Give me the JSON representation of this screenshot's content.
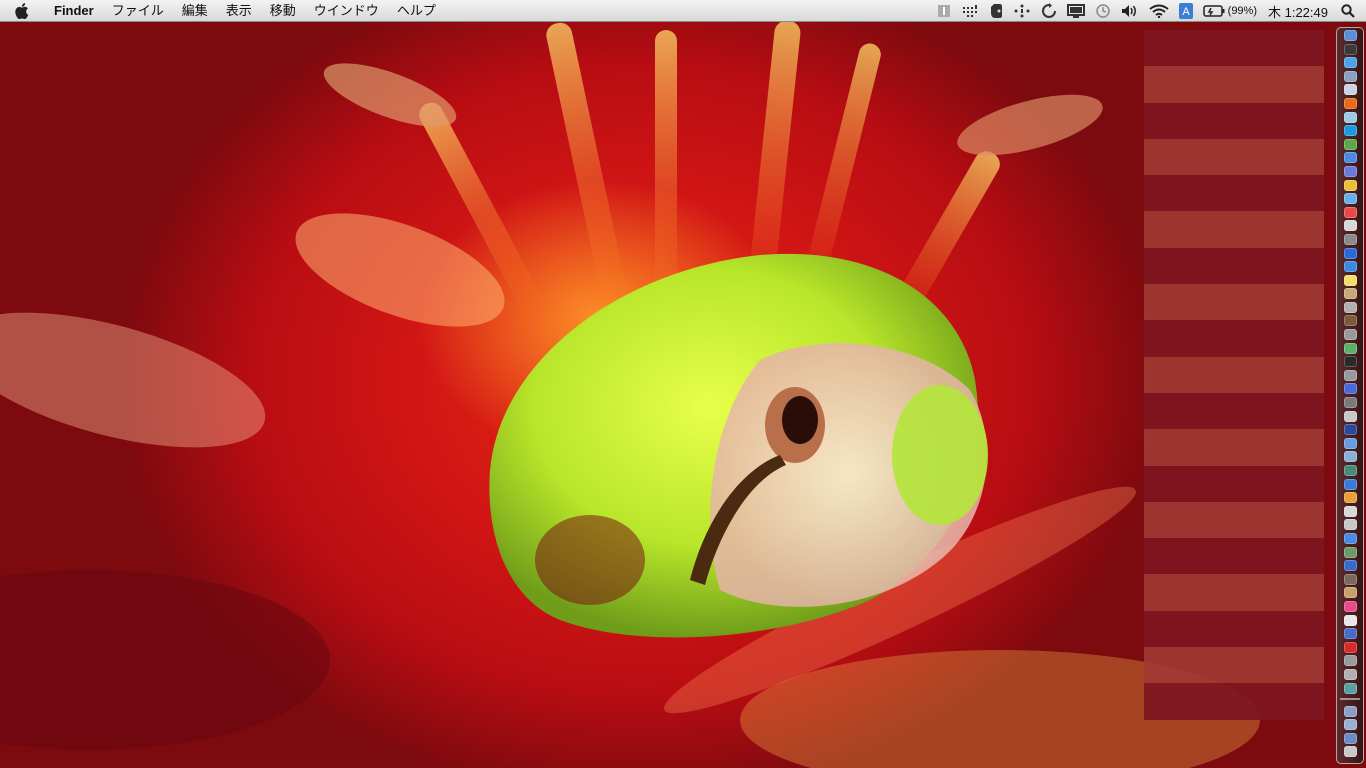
{
  "menubar": {
    "apple_icon": "apple-logo-icon",
    "app_name": "Finder",
    "menus": [
      "ファイル",
      "編集",
      "表示",
      "移動",
      "ウインドウ",
      "ヘルプ"
    ],
    "status_icons": [
      "info-icon",
      "menu-extra-icon",
      "evernote-icon",
      "bluetooth-icon",
      "sync-icon",
      "display-icon",
      "time-machine-icon",
      "volume-icon",
      "wifi-icon",
      "input-method-icon"
    ],
    "input_method_label": "A",
    "battery_percent": "(99%)",
    "clock": "木 1:22:49",
    "spotlight_icon": "spotlight-search-icon"
  },
  "desktop": {
    "wallpaper": "frog-in-red-flower",
    "pixelated_region": "redacted-desktop-items"
  },
  "dock": {
    "position": "right",
    "apps": [
      {
        "name": "finder-icon",
        "color": "#5a8fd8"
      },
      {
        "name": "dashboard-icon",
        "color": "#3a3a3a"
      },
      {
        "name": "safari-icon",
        "color": "#4aa3e8"
      },
      {
        "name": "mail-icon",
        "color": "#8aa0c0"
      },
      {
        "name": "preview-icon",
        "color": "#c8d4e4"
      },
      {
        "name": "firefox-icon",
        "color": "#e86a1a"
      },
      {
        "name": "twitter-icon",
        "color": "#9ccbe8"
      },
      {
        "name": "skype-icon",
        "color": "#1a9ae0"
      },
      {
        "name": "evernote-icon",
        "color": "#5aa84a"
      },
      {
        "name": "chrome-icon",
        "color": "#4a8ae0"
      },
      {
        "name": "itunes-icon",
        "color": "#6a7ad8"
      },
      {
        "name": "photo-icon",
        "color": "#e8c03a"
      },
      {
        "name": "app-store-icon",
        "color": "#6ab0e8"
      },
      {
        "name": "calendar-icon",
        "color": "#e84a4a"
      },
      {
        "name": "textedit-icon",
        "color": "#d8d8d8"
      },
      {
        "name": "system-prefs-icon",
        "color": "#8a8a8a"
      },
      {
        "name": "earth-icon",
        "color": "#2a6ad8"
      },
      {
        "name": "ie-icon",
        "color": "#3a8ae0"
      },
      {
        "name": "stickies-icon",
        "color": "#f0e06a"
      },
      {
        "name": "photos-icon",
        "color": "#c8a87a"
      },
      {
        "name": "image-icon",
        "color": "#b0b0b0"
      },
      {
        "name": "tools-icon",
        "color": "#7a5a3a"
      },
      {
        "name": "automator-icon",
        "color": "#9a9a9a"
      },
      {
        "name": "notes-icon",
        "color": "#5ab06a"
      },
      {
        "name": "terminal-icon",
        "color": "#2a2a2a"
      },
      {
        "name": "cloud-icon",
        "color": "#9a9a9a"
      },
      {
        "name": "presentation-icon",
        "color": "#4a6ad8"
      },
      {
        "name": "vmware-icon",
        "color": "#7a7a7a"
      },
      {
        "name": "pen-icon",
        "color": "#c8c8c8"
      },
      {
        "name": "photoshop-icon",
        "color": "#2a4a9a"
      },
      {
        "name": "folder-icon",
        "color": "#6a9ae0"
      },
      {
        "name": "network-icon",
        "color": "#8ab0d8"
      },
      {
        "name": "screen-icon",
        "color": "#4a8a7a"
      },
      {
        "name": "quicktime-icon",
        "color": "#3a7ad8"
      },
      {
        "name": "pencil-icon",
        "color": "#e8a03a"
      },
      {
        "name": "document-icon",
        "color": "#d8d8d8"
      },
      {
        "name": "paint-icon",
        "color": "#c8c8c8"
      },
      {
        "name": "messages-icon",
        "color": "#4a8ae0"
      },
      {
        "name": "spreadsheet-icon",
        "color": "#6a9a6a"
      },
      {
        "name": "nav-icon",
        "color": "#3a6ac8"
      },
      {
        "name": "lightroom-icon",
        "color": "#7a6a5a"
      },
      {
        "name": "address-book-icon",
        "color": "#c8a06a"
      },
      {
        "name": "record-icon",
        "color": "#e84a8a"
      },
      {
        "name": "chef-icon",
        "color": "#e8e8e8"
      },
      {
        "name": "globe-icon",
        "color": "#4a6ac8"
      },
      {
        "name": "acrobat-icon",
        "color": "#d82a2a"
      },
      {
        "name": "script-icon",
        "color": "#9a9a9a"
      },
      {
        "name": "disk-icon",
        "color": "#b0b0b0"
      },
      {
        "name": "compass-icon",
        "color": "#5aa0a0"
      }
    ],
    "trailing": [
      {
        "name": "downloads-stack-icon",
        "color": "#8aa0c8"
      },
      {
        "name": "documents-stack-icon",
        "color": "#9ab0d0"
      },
      {
        "name": "applications-folder-icon",
        "color": "#6a8ac8"
      },
      {
        "name": "trash-icon",
        "color": "#c8c8c8"
      }
    ]
  }
}
